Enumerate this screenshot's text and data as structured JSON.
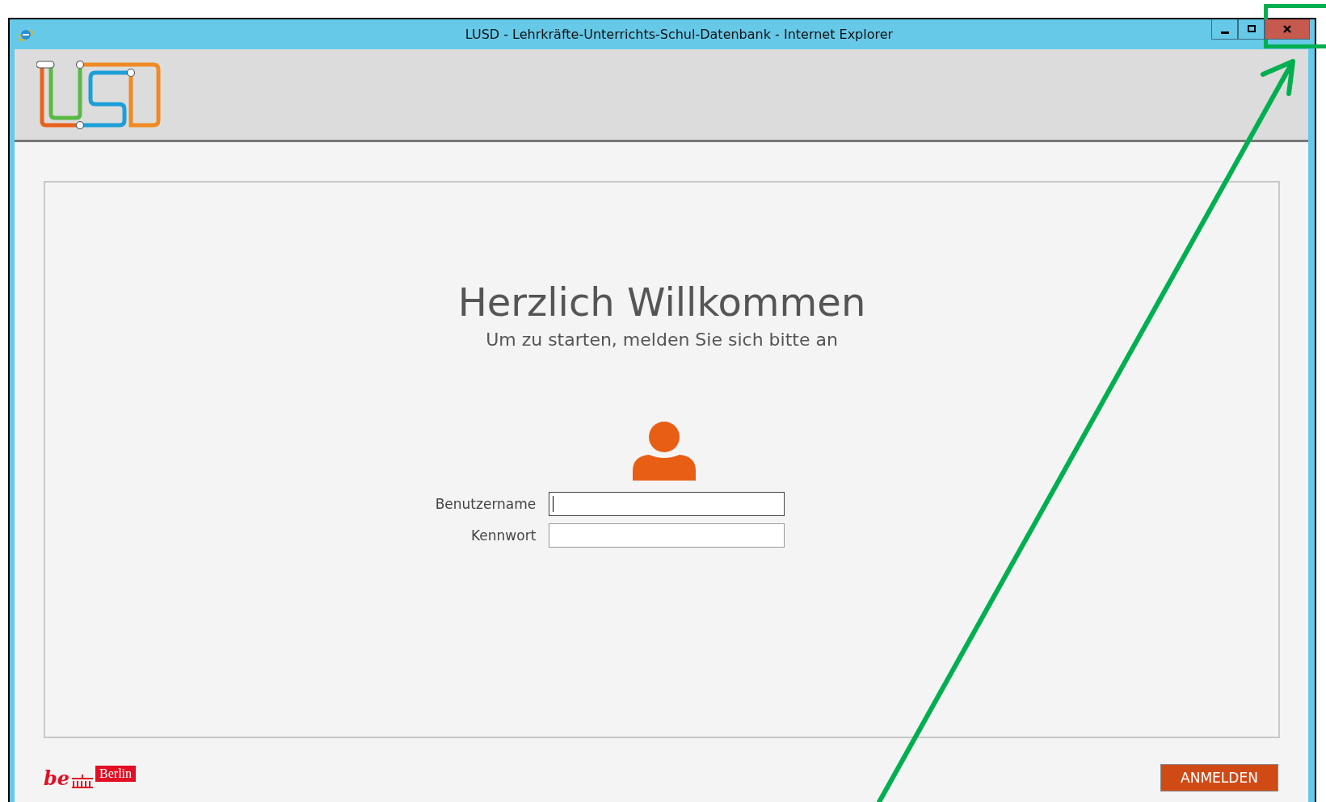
{
  "window": {
    "title": "LUSD - Lehrkräfte-Unterrichts-Schul-Datenbank - Internet Explorer"
  },
  "login": {
    "heading": "Herzlich Willkommen",
    "subheading": "Um zu starten, melden Sie sich bitte an",
    "fields": [
      {
        "label": "Benutzername",
        "focused": true
      },
      {
        "label": "Kennwort",
        "focused": false
      }
    ]
  },
  "footer": {
    "logo_mark": "be",
    "logo_text": "Berlin",
    "button": "ANMELDEN"
  }
}
